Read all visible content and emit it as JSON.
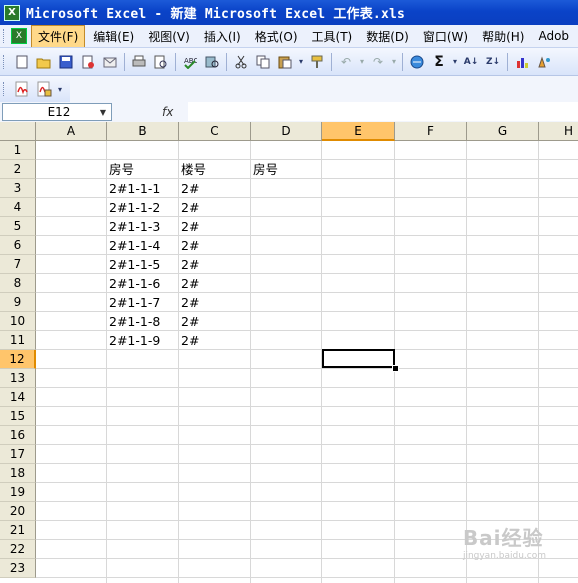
{
  "window": {
    "title": "Microsoft Excel - 新建 Microsoft Excel 工作表.xls",
    "app_icon": "excel-icon"
  },
  "menu": {
    "items": [
      "文件(F)",
      "编辑(E)",
      "视图(V)",
      "插入(I)",
      "格式(O)",
      "工具(T)",
      "数据(D)",
      "窗口(W)",
      "帮助(H)",
      "Adob"
    ],
    "active_index": 0
  },
  "toolbar": {
    "standard_icons": [
      "new-icon",
      "open-icon",
      "save-icon",
      "permission-icon",
      "email-icon",
      "print-icon",
      "print-preview-icon",
      "spelling-icon",
      "research-icon",
      "cut-icon",
      "copy-icon",
      "paste-icon",
      "format-painter-icon",
      "undo-icon",
      "redo-icon",
      "hyperlink-icon",
      "autosum-icon",
      "sort-ascending-icon",
      "sort-descending-icon",
      "chart-wizard-icon",
      "drawing-icon"
    ],
    "autosum_label": "Σ",
    "pdf_icons": [
      "pdf-convert-icon",
      "pdf-settings-icon"
    ]
  },
  "formula_bar": {
    "name_box": "E12",
    "fx_label": "fx",
    "content": ""
  },
  "sheet": {
    "columns": [
      "A",
      "B",
      "C",
      "D",
      "E",
      "F",
      "G",
      "H"
    ],
    "rows": [
      "1",
      "2",
      "3",
      "4",
      "5",
      "6",
      "7",
      "8",
      "9",
      "10",
      "11",
      "12",
      "13",
      "14",
      "15",
      "16",
      "17",
      "18",
      "19",
      "20",
      "21",
      "22",
      "23"
    ],
    "selected_column": "E",
    "selected_row": "12",
    "cells": {
      "B2": "房号",
      "C2": "楼号",
      "D2": "房号",
      "B3": "2#1-1-1",
      "C3": "2#",
      "B4": "2#1-1-2",
      "C4": "2#",
      "B5": "2#1-1-3",
      "C5": "2#",
      "B6": "2#1-1-4",
      "C6": "2#",
      "B7": "2#1-1-5",
      "C7": "2#",
      "B8": "2#1-1-6",
      "C8": "2#",
      "B9": "2#1-1-7",
      "C9": "2#",
      "B10": "2#1-1-8",
      "C10": "2#",
      "B11": "2#1-1-9",
      "C11": "2#"
    }
  },
  "watermark": {
    "text": "Bai经验",
    "sub": "jingyan.baidu.com"
  }
}
